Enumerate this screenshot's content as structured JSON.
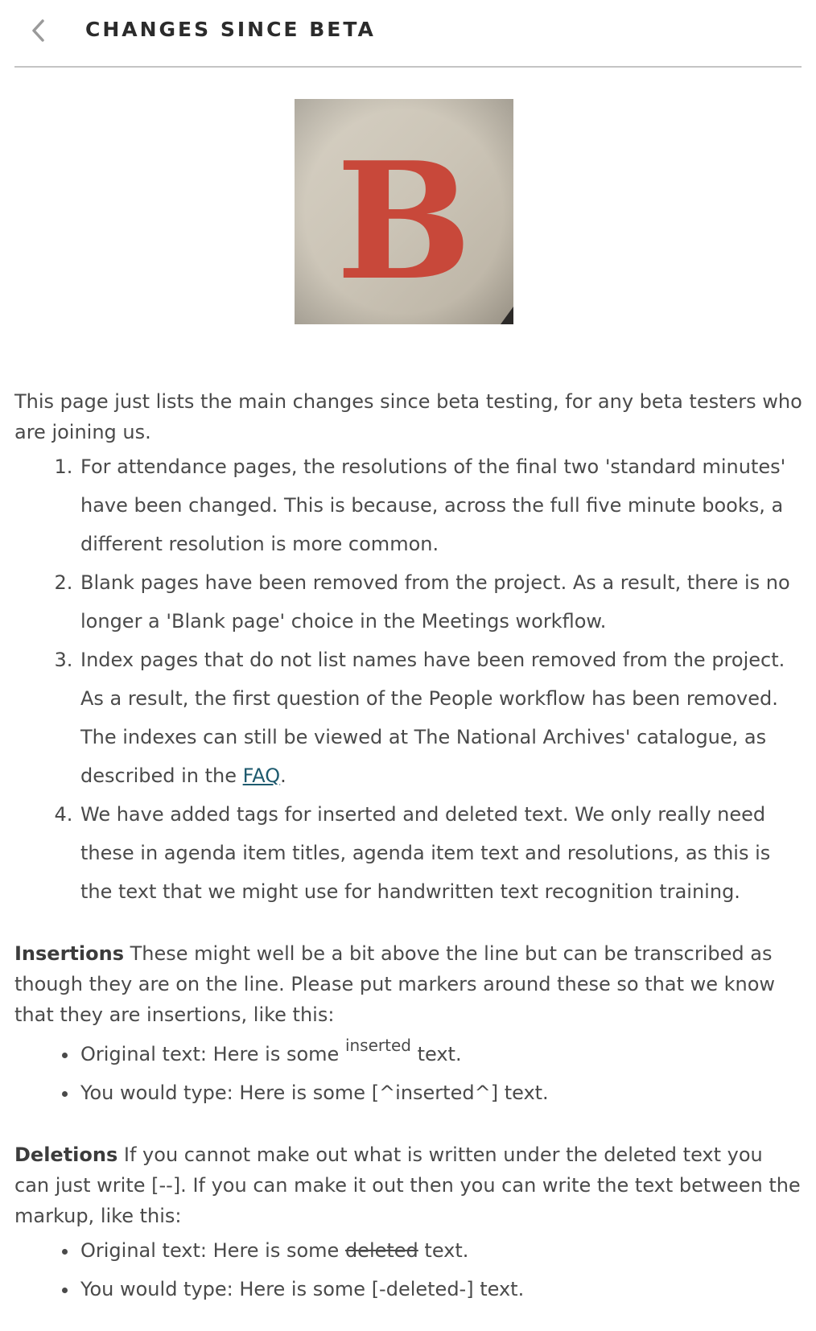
{
  "header": {
    "back_icon": "chevron-left-icon",
    "title": "CHANGES SINCE BETA"
  },
  "hero_image": {
    "letter": "B",
    "letter_color": "#c8483a",
    "background_color": "#c9c2b4"
  },
  "intro": "This page just lists the main changes since beta testing, for any beta testers who are joining us.",
  "changes": [
    {
      "text": "For attendance pages, the resolutions of the final two 'standard minutes' have been changed. This is because, across the full five minute books, a different resolution is more common."
    },
    {
      "text": "Blank pages have been removed from the project. As a result, there is no longer a 'Blank page' choice in the Meetings workflow."
    },
    {
      "text": "Index pages that do not list names have been removed from the project. As a result, the first question of the People workflow has been removed. The indexes can still be viewed at The National Archives' catalogue, as described in the ",
      "link_label": "FAQ",
      "after": "."
    },
    {
      "text": "We have added tags for inserted and deleted text. We only really need these in agenda item titles, agenda item text and resolutions, as this is the text that we might use for handwritten text recognition training."
    }
  ],
  "insertions": {
    "heading": "Insertions",
    "body": " These might well be a bit above the line but can be transcribed as though they are on the line. Please put markers around these so that we know that they are insertions, like this:",
    "example_original_prefix": "Original text: Here is some ",
    "example_original_sup": "inserted",
    "example_original_suffix": " text.",
    "example_typed": "You would type: Here is some [^inserted^] text."
  },
  "deletions": {
    "heading": "Deletions",
    "body": " If you cannot make out what is written under the deleted text you can just write [--]. If you can make it out then you can write the text between the markup, like this:",
    "example_original_prefix": "Original text: Here is some ",
    "example_original_struck": "deleted",
    "example_original_suffix": " text.",
    "example_typed": "You would type: Here is some [-deleted-] text."
  },
  "colors": {
    "text": "#4a4a4a",
    "link": "#1e5a6e",
    "divider": "#c4c4c4"
  }
}
